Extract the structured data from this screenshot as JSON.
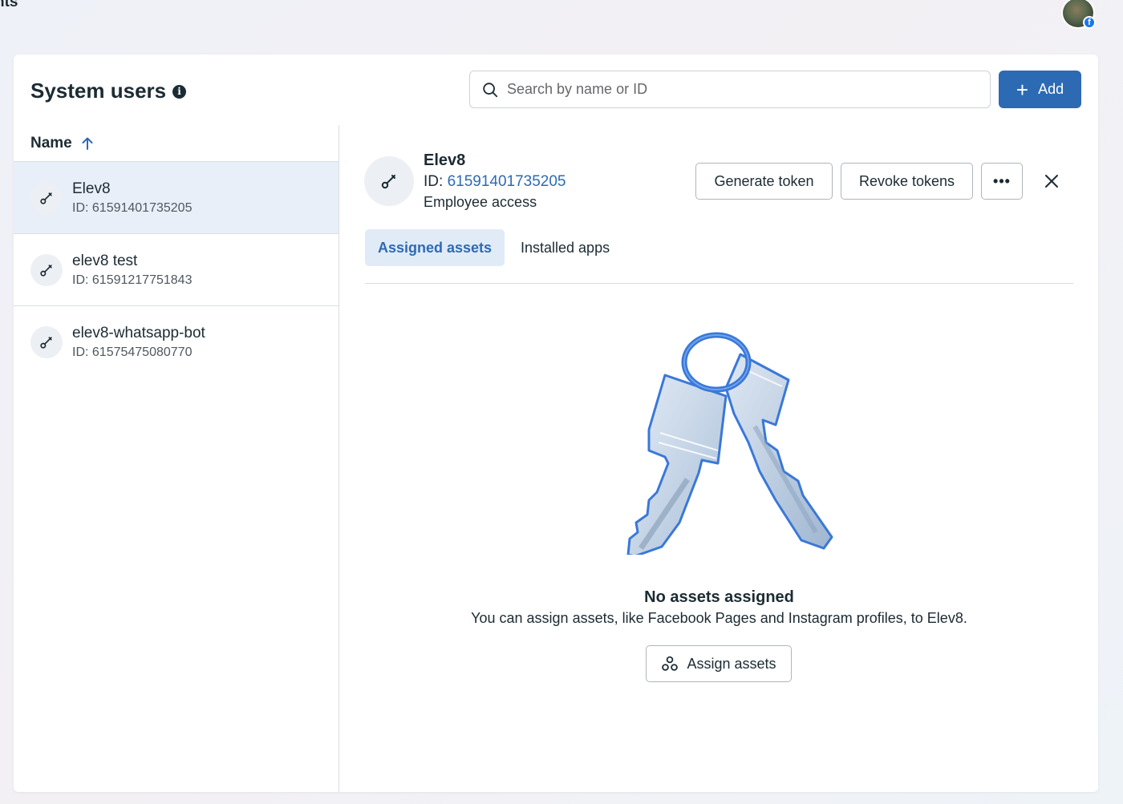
{
  "header": {
    "title_fragment": "nts"
  },
  "panel": {
    "title": "System users",
    "search": {
      "placeholder": "Search by name or ID",
      "value": ""
    },
    "add_label": "Add"
  },
  "list": {
    "sort_label": "Name",
    "users": [
      {
        "name": "Elev8",
        "id_text": "ID: 61591401735205",
        "selected": true
      },
      {
        "name": "elev8 test",
        "id_text": "ID: 61591217751843",
        "selected": false
      },
      {
        "name": "elev8-whatsapp-bot",
        "id_text": "ID: 61575475080770",
        "selected": false
      }
    ]
  },
  "detail": {
    "name": "Elev8",
    "id_label": "ID:",
    "id_value": "61591401735205",
    "access": "Employee access",
    "generate_token_label": "Generate token",
    "revoke_tokens_label": "Revoke tokens",
    "more_label": "•••",
    "tabs": [
      {
        "label": "Assigned assets",
        "active": true
      },
      {
        "label": "Installed apps",
        "active": false
      }
    ],
    "empty_title": "No assets assigned",
    "empty_description": "You can assign assets, like Facebook Pages and Instagram profiles, to Elev8.",
    "assign_label": "Assign assets"
  },
  "colors": {
    "accent": "#2d6ab4",
    "selected_row": "#e9eff8",
    "active_tab_bg": "#e1ebf7",
    "text": "#1c2b33"
  },
  "icons": {
    "user": "wrench-icon",
    "search": "search-icon",
    "sort": "arrow-up-icon",
    "close": "close-icon",
    "assign": "assets-icon",
    "info": "info-icon"
  }
}
